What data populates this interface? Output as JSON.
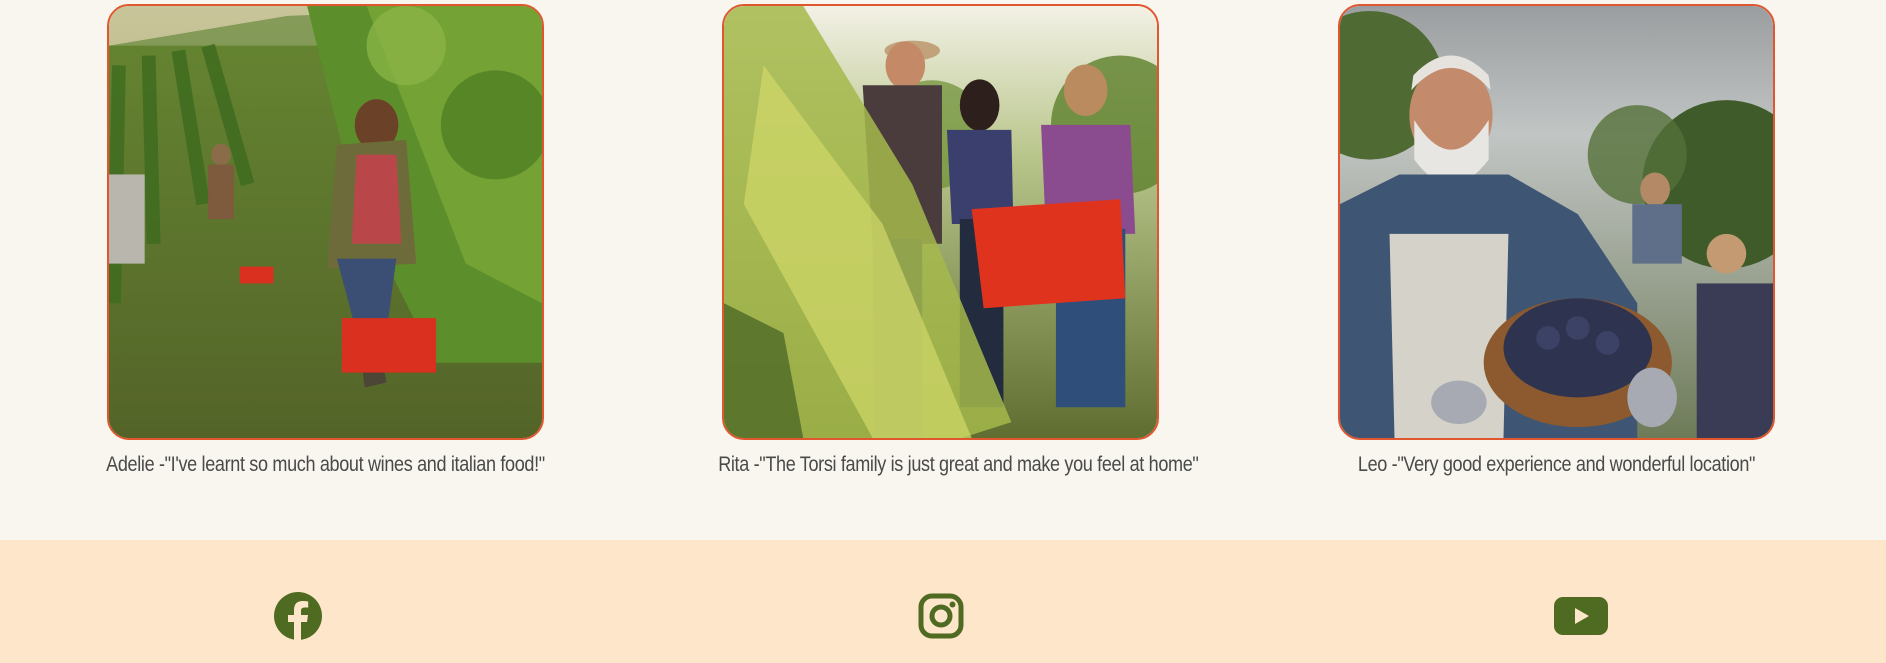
{
  "testimonials": [
    {
      "name": "Adelie",
      "quote": "Adelie -\"I've learnt so much about wines and italian food!\""
    },
    {
      "name": "Rita",
      "quote": "Rita -\"The Torsi family is just great and make you feel at home\""
    },
    {
      "name": "Leo",
      "quote": "Leo -\"Very good experience and wonderful location\""
    }
  ],
  "footer": {
    "social": [
      {
        "icon": "facebook-icon"
      },
      {
        "icon": "instagram-icon"
      },
      {
        "icon": "youtube-icon"
      }
    ]
  },
  "colors": {
    "background": "#f8f6ee",
    "footer_background": "#fde6c9",
    "card_border": "#e0572f",
    "caption_text": "#4a4a4a",
    "social_icon": "#4f6b22"
  }
}
